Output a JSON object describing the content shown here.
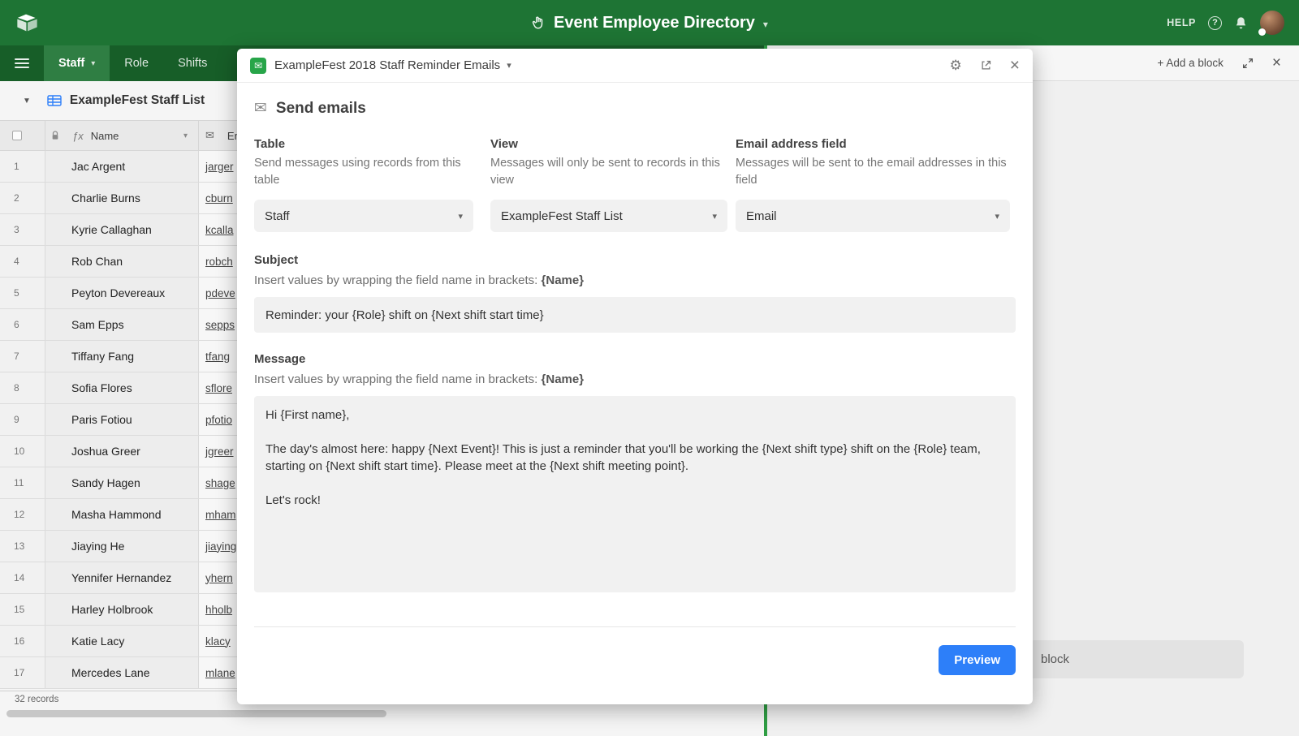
{
  "colors": {
    "header_green": "#1e7434",
    "tabbar_green": "#175e28",
    "active_tab_green": "#2f7e43",
    "panel_divider_green": "#2f9e44",
    "block_icon_green": "#27a549",
    "accent_blue": "#2d7ff9"
  },
  "icons": {
    "caret_down": "▾",
    "collapse_triangle": "▼",
    "envelope": "✉",
    "gear": "⚙",
    "close": "×",
    "help_q": "?",
    "fx": "ƒx"
  },
  "topbar": {
    "title": "Event Employee Directory",
    "help_label": "HELP"
  },
  "tabs": {
    "items": [
      {
        "label": "Staff"
      },
      {
        "label": "Role"
      },
      {
        "label": "Shifts"
      }
    ]
  },
  "table_panel": {
    "view_title": "ExampleFest Staff List",
    "name_header": "Name",
    "email_header": "Em",
    "records_summary": "32 records",
    "rows": [
      {
        "num": "1",
        "name": "Jac Argent",
        "email": "jarger"
      },
      {
        "num": "2",
        "name": "Charlie Burns",
        "email": "cburn"
      },
      {
        "num": "3",
        "name": "Kyrie Callaghan",
        "email": "kcalla"
      },
      {
        "num": "4",
        "name": "Rob Chan",
        "email": "robch"
      },
      {
        "num": "5",
        "name": "Peyton Devereaux",
        "email": "pdeve"
      },
      {
        "num": "6",
        "name": "Sam Epps",
        "email": "sepps"
      },
      {
        "num": "7",
        "name": "Tiffany Fang",
        "email": "tfang"
      },
      {
        "num": "8",
        "name": "Sofia Flores",
        "email": "sflore"
      },
      {
        "num": "9",
        "name": "Paris Fotiou",
        "email": "pfotio"
      },
      {
        "num": "10",
        "name": "Joshua Greer",
        "email": "jgreer"
      },
      {
        "num": "11",
        "name": "Sandy Hagen",
        "email": "shage"
      },
      {
        "num": "12",
        "name": "Masha Hammond",
        "email": "mham"
      },
      {
        "num": "13",
        "name": "Jiaying He",
        "email": "jiaying"
      },
      {
        "num": "14",
        "name": "Yennifer Hernandez",
        "email": "yhern"
      },
      {
        "num": "15",
        "name": "Harley Holbrook",
        "email": "hholb"
      },
      {
        "num": "16",
        "name": "Katie Lacy",
        "email": "klacy"
      },
      {
        "num": "17",
        "name": "Mercedes Lane",
        "email": "mlane"
      }
    ]
  },
  "blocks_panel": {
    "add_block_label": "+ Add a block",
    "partial_block_label": "block"
  },
  "modal": {
    "title": "ExampleFest 2018 Staff Reminder Emails",
    "heading": "Send emails",
    "table_field": {
      "label": "Table",
      "description": "Send messages using records from this table",
      "value": "Staff"
    },
    "view_field": {
      "label": "View",
      "description": "Messages will only be sent to records in this view",
      "value": "ExampleFest Staff List"
    },
    "email_field": {
      "label": "Email address field",
      "description": "Messages will be sent to the email addresses in this field",
      "value": "Email"
    },
    "subject": {
      "label": "Subject",
      "helper_prefix": "Insert values by wrapping the field name in brackets: ",
      "helper_token": "{Name}",
      "value": "Reminder: your {Role} shift on {Next shift start time}"
    },
    "message": {
      "label": "Message",
      "helper_prefix": "Insert values by wrapping the field name in brackets: ",
      "helper_token": "{Name}",
      "value": "Hi {First name},\n\nThe day's almost here: happy {Next Event}! This is just a reminder that you'll be working the {Next shift type} shift on the {Role} team, starting on {Next shift start time}. Please meet at the {Next shift meeting point}.\n\nLet's rock!"
    },
    "preview_label": "Preview"
  }
}
